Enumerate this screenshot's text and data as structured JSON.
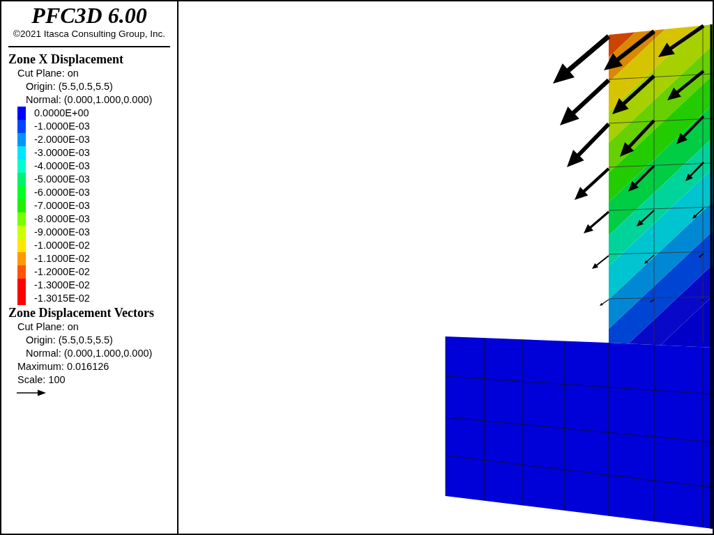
{
  "header": {
    "title": "PFC3D 6.00",
    "copyright": "©2021 Itasca Consulting Group, Inc."
  },
  "contour_legend": {
    "title": "Zone X Displacement",
    "cut_plane": "Cut Plane: on",
    "origin": "Origin: (5.5,0.5,5.5)",
    "normal": "Normal: (0.000,1.000,0.000)",
    "levels": [
      {
        "label": "0.0000E+00",
        "color": "#0000ff"
      },
      {
        "label": "-1.0000E-03",
        "color": "#0044ff"
      },
      {
        "label": "-2.0000E-03",
        "color": "#0094ff"
      },
      {
        "label": "-3.0000E-03",
        "color": "#00e6ff"
      },
      {
        "label": "-4.0000E-03",
        "color": "#00ffcc"
      },
      {
        "label": "-5.0000E-03",
        "color": "#00f070"
      },
      {
        "label": "-6.0000E-03",
        "color": "#00ff22"
      },
      {
        "label": "-7.0000E-03",
        "color": "#22f000"
      },
      {
        "label": "-8.0000E-03",
        "color": "#77ff00"
      },
      {
        "label": "-9.0000E-03",
        "color": "#ccff00"
      },
      {
        "label": "-1.0000E-02",
        "color": "#ffe600"
      },
      {
        "label": "-1.1000E-02",
        "color": "#ff9900"
      },
      {
        "label": "-1.2000E-02",
        "color": "#ff5500"
      },
      {
        "label": "-1.3000E-02",
        "color": "#ff0000"
      },
      {
        "label": "-1.3015E-02",
        "color": "#ff0000"
      }
    ]
  },
  "vector_legend": {
    "title": "Zone Displacement Vectors",
    "cut_plane": "Cut Plane: on",
    "origin": "Origin: (5.5,0.5,5.5)",
    "normal": "Normal: (0.000,1.000,0.000)",
    "maximum": "Maximum: 0.016126",
    "scale": "Scale: 100"
  }
}
